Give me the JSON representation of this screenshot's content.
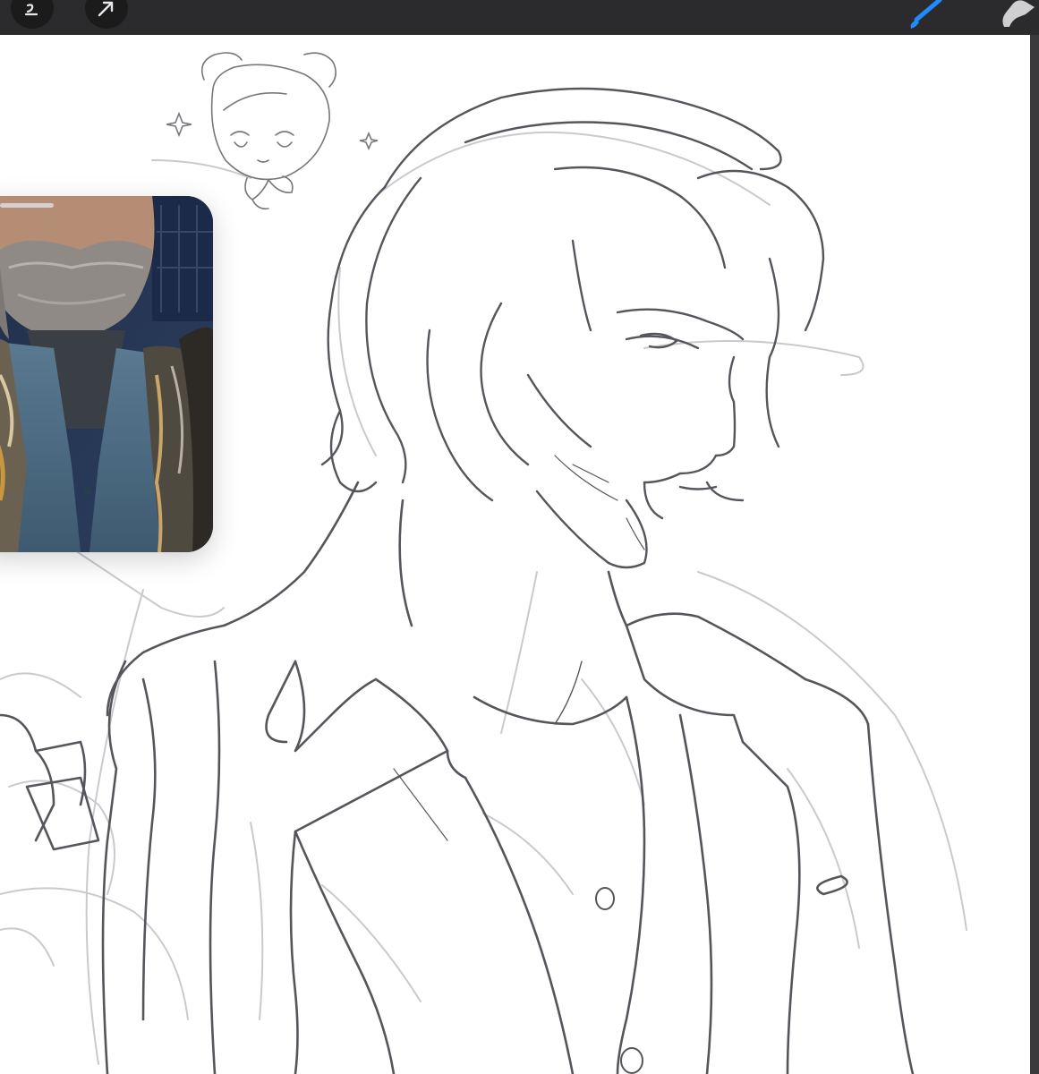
{
  "app": {
    "toolbar": {
      "left_tools": [
        {
          "icon": "modify-icon"
        },
        {
          "icon": "transform-arrow-icon"
        }
      ],
      "right_tools": [
        {
          "icon": "brush-icon",
          "color": "#1e8bff"
        },
        {
          "icon": "smudge-icon",
          "color": "#cfcfd2"
        }
      ]
    },
    "canvas": {
      "background": "#ffffff",
      "sketch_color": "#55565c",
      "guide_color": "#c9cacd"
    },
    "reference_window": {
      "content": "reference-photo"
    }
  }
}
